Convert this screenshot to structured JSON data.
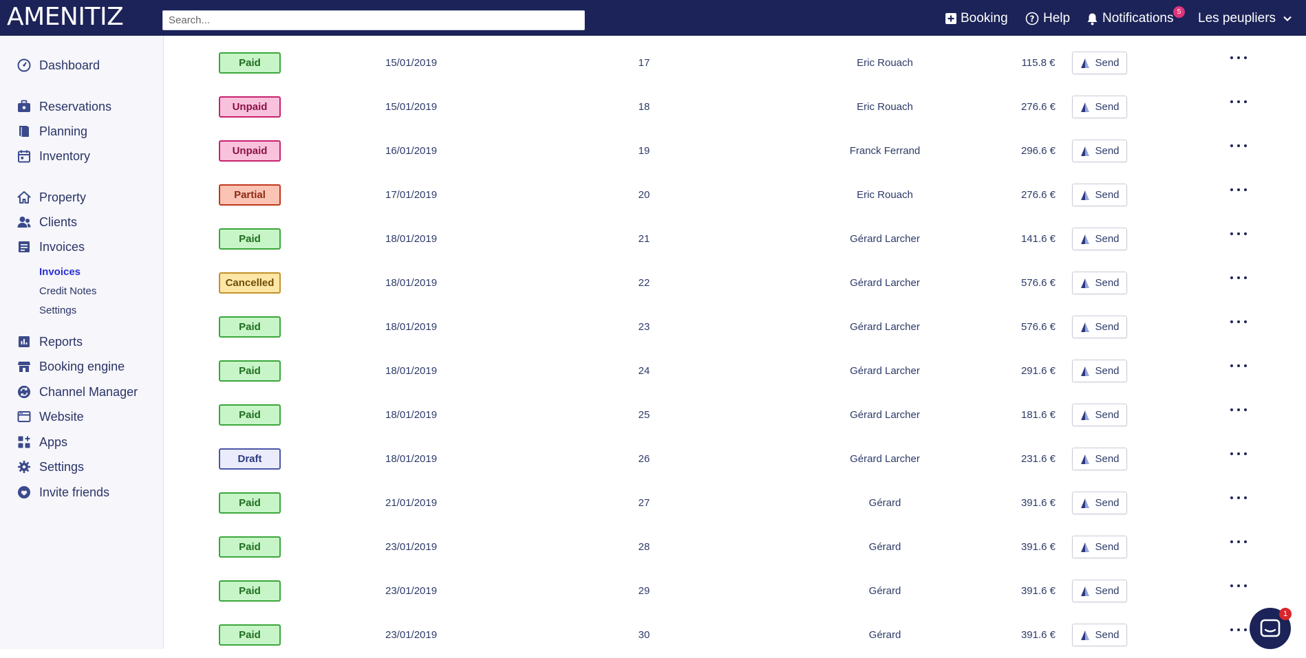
{
  "header": {
    "logo": "AMENITIZ",
    "search_placeholder": "Search...",
    "booking_label": "Booking",
    "help_label": "Help",
    "notifications_label": "Notifications",
    "notifications_count": "5",
    "property_name": "Les peupliers"
  },
  "sidebar": {
    "dashboard": "Dashboard",
    "reservations": "Reservations",
    "planning": "Planning",
    "inventory": "Inventory",
    "property": "Property",
    "clients": "Clients",
    "invoices": "Invoices",
    "invoices_sub": {
      "invoices": "Invoices",
      "credit_notes": "Credit Notes",
      "settings": "Settings"
    },
    "reports": "Reports",
    "booking_engine": "Booking engine",
    "channel_manager": "Channel Manager",
    "website": "Website",
    "apps": "Apps",
    "settings": "Settings",
    "invite_friends": "Invite friends"
  },
  "send_label": "Send",
  "rows": [
    {
      "status": "Paid",
      "kind": "paid",
      "date": "15/01/2019",
      "number": "17",
      "client": "Eric Rouach",
      "amount": "115.8 €"
    },
    {
      "status": "Unpaid",
      "kind": "unpaid",
      "date": "15/01/2019",
      "number": "18",
      "client": "Eric Rouach",
      "amount": "276.6 €"
    },
    {
      "status": "Unpaid",
      "kind": "unpaid",
      "date": "16/01/2019",
      "number": "19",
      "client": "Franck Ferrand",
      "amount": "296.6 €"
    },
    {
      "status": "Partial",
      "kind": "partial",
      "date": "17/01/2019",
      "number": "20",
      "client": "Eric Rouach",
      "amount": "276.6 €"
    },
    {
      "status": "Paid",
      "kind": "paid",
      "date": "18/01/2019",
      "number": "21",
      "client": "Gérard Larcher",
      "amount": "141.6 €"
    },
    {
      "status": "Cancelled",
      "kind": "cancelled",
      "date": "18/01/2019",
      "number": "22",
      "client": "Gérard Larcher",
      "amount": "576.6 €"
    },
    {
      "status": "Paid",
      "kind": "paid",
      "date": "18/01/2019",
      "number": "23",
      "client": "Gérard Larcher",
      "amount": "576.6 €"
    },
    {
      "status": "Paid",
      "kind": "paid",
      "date": "18/01/2019",
      "number": "24",
      "client": "Gérard Larcher",
      "amount": "291.6 €"
    },
    {
      "status": "Paid",
      "kind": "paid",
      "date": "18/01/2019",
      "number": "25",
      "client": "Gérard Larcher",
      "amount": "181.6 €"
    },
    {
      "status": "Draft",
      "kind": "draft",
      "date": "18/01/2019",
      "number": "26",
      "client": "Gérard Larcher",
      "amount": "231.6 €"
    },
    {
      "status": "Paid",
      "kind": "paid",
      "date": "21/01/2019",
      "number": "27",
      "client": "Gérard",
      "amount": "391.6 €"
    },
    {
      "status": "Paid",
      "kind": "paid",
      "date": "23/01/2019",
      "number": "28",
      "client": "Gérard",
      "amount": "391.6 €"
    },
    {
      "status": "Paid",
      "kind": "paid",
      "date": "23/01/2019",
      "number": "29",
      "client": "Gérard",
      "amount": "391.6 €"
    },
    {
      "status": "Paid",
      "kind": "paid",
      "date": "23/01/2019",
      "number": "30",
      "client": "Gérard",
      "amount": "391.6 €"
    }
  ],
  "chat": {
    "unread_count": "1"
  },
  "colors": {
    "header_bg": "#1b2358",
    "sidebar_bg": "#f6f6fb",
    "active_link": "#2a2fd0"
  }
}
